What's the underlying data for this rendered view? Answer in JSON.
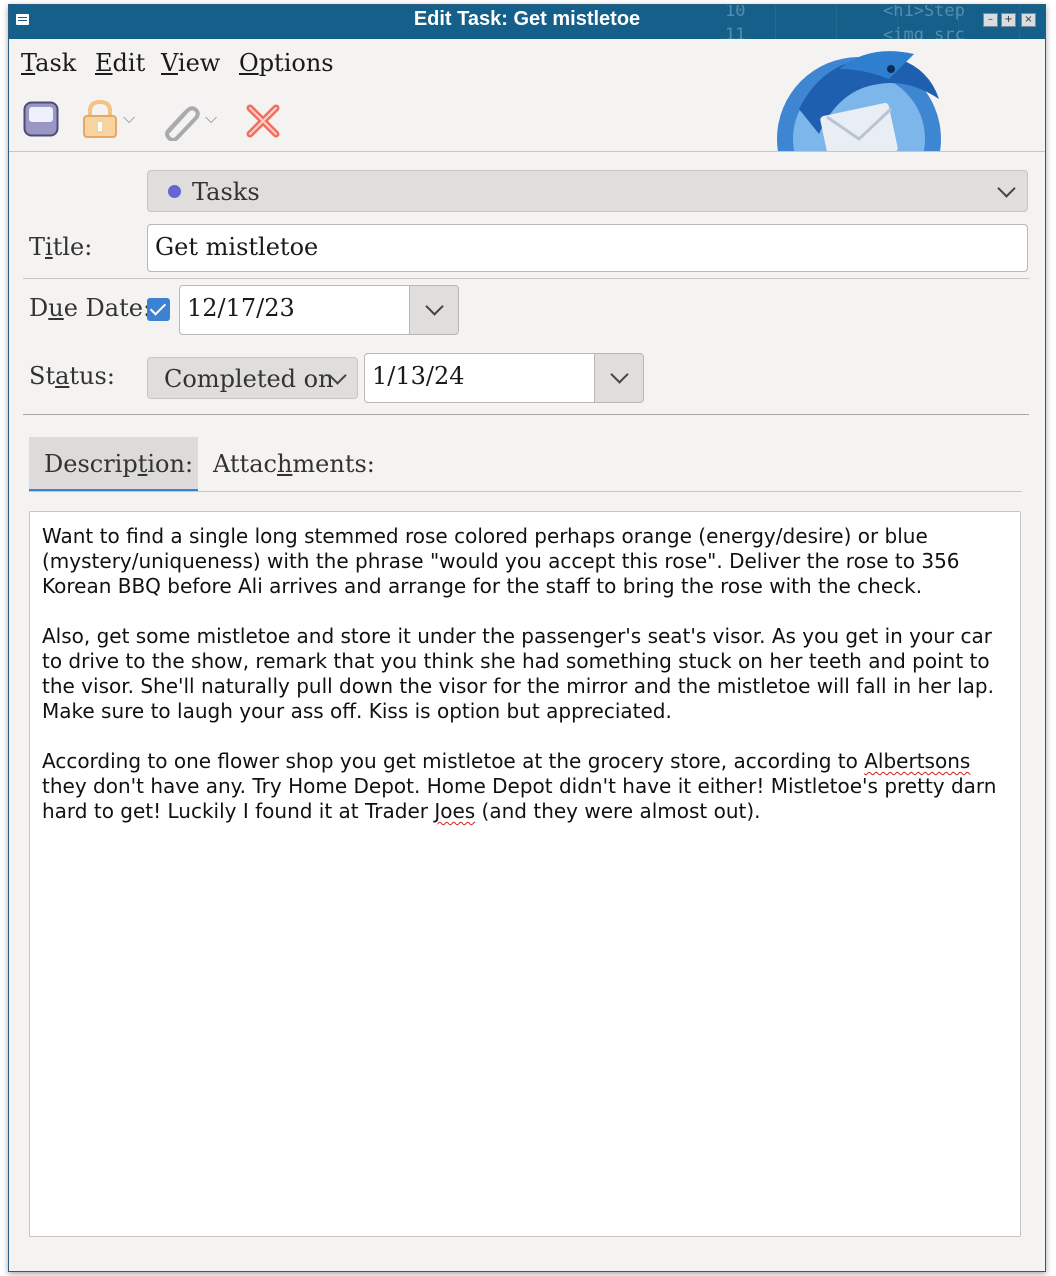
{
  "window": {
    "title": "Edit Task: Get mistletoe",
    "background_text_1": "10",
    "background_text_2": "<h1>Step",
    "background_text_3": "11",
    "background_text_4": "<img src"
  },
  "menubar": {
    "items": [
      {
        "key": "T",
        "rest": "ask"
      },
      {
        "key": "E",
        "rest": "dit"
      },
      {
        "key": "V",
        "rest": "iew"
      },
      {
        "key": "O",
        "rest": "ptions"
      }
    ]
  },
  "toolbar": {
    "icons": [
      "save-icon",
      "lock-icon",
      "attachment-icon",
      "delete-icon"
    ]
  },
  "form": {
    "calendar": "Tasks",
    "calendar_color": "#6a63d6",
    "title_label_pre": "T",
    "title_label_key": "i",
    "title_label_post": "tle:",
    "title_value": "Get mistletoe",
    "due_label_pre": "D",
    "due_label_key": "u",
    "due_label_post": "e Date:",
    "due_checked": true,
    "due_value": "12/17/23",
    "status_label_pre": "St",
    "status_label_key": "a",
    "status_label_post": "tus:",
    "status_value": "Completed on",
    "completed_date": "1/13/24"
  },
  "tabs": {
    "description": {
      "pre": "Descrip",
      "key": "t",
      "post": "ion:"
    },
    "attachments": {
      "pre": "Attac",
      "key": "h",
      "post": "ments:"
    }
  },
  "description": {
    "p1": "Want to find a single long stemmed rose colored perhaps orange (energy/desire) or blue (mystery/uniqueness) with the phrase \"would you accept this rose\". Deliver the rose to 356 Korean BBQ before Ali arrives and arrange for the staff to bring the rose with the check.",
    "p2": "Also, get some mistletoe and store it under the passenger's seat's visor. As you get in your car to drive to the show, remark that you think she had something stuck on her teeth and point to the visor. She'll naturally pull down the visor for the mirror and the mistletoe will fall in her lap. Make sure to laugh your ass off. Kiss is option but appreciated.",
    "p3_a": "According to one flower shop you get mistletoe at the grocery store, according to ",
    "p3_b": "Albertsons",
    "p3_c": " they don't have any. Try Home Depot. Home Depot didn't have it either! Mistletoe's pretty darn hard to get! Luckily I found it at Trader ",
    "p3_d": "Joes",
    "p3_e": " (and they were almost out)."
  },
  "colors": {
    "titlebar": "#14608a",
    "accent": "#3b82d4"
  }
}
